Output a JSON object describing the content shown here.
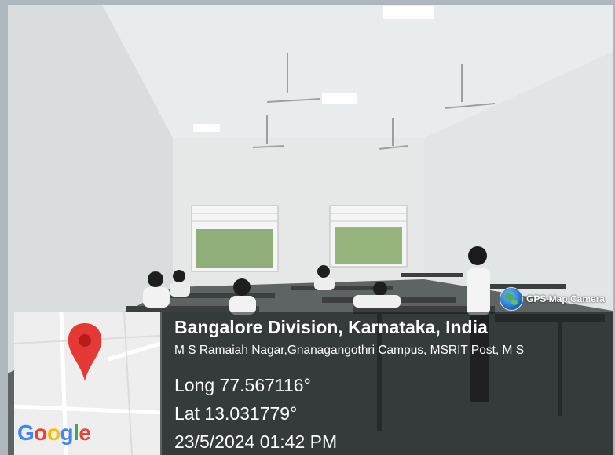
{
  "overlay": {
    "title": "Bangalore Division, Karnataka, India",
    "address": "M S Ramaiah Nagar,Gnanagangothri Campus, MSRIT Post, M S",
    "longitude": "Long 77.567116°",
    "latitude": "Lat 13.031779°",
    "datetime": "23/5/2024 01:42 PM"
  },
  "badge": {
    "label": "GPS Map Camera",
    "icon": "globe-icon"
  },
  "map": {
    "logo_letters": [
      "G",
      "o",
      "o",
      "g",
      "l",
      "e"
    ],
    "pin_icon": "location-pin-icon",
    "pin_color": "#e53935"
  },
  "colors": {
    "overlay_bg": "#14181a",
    "text": "#ffffff"
  }
}
